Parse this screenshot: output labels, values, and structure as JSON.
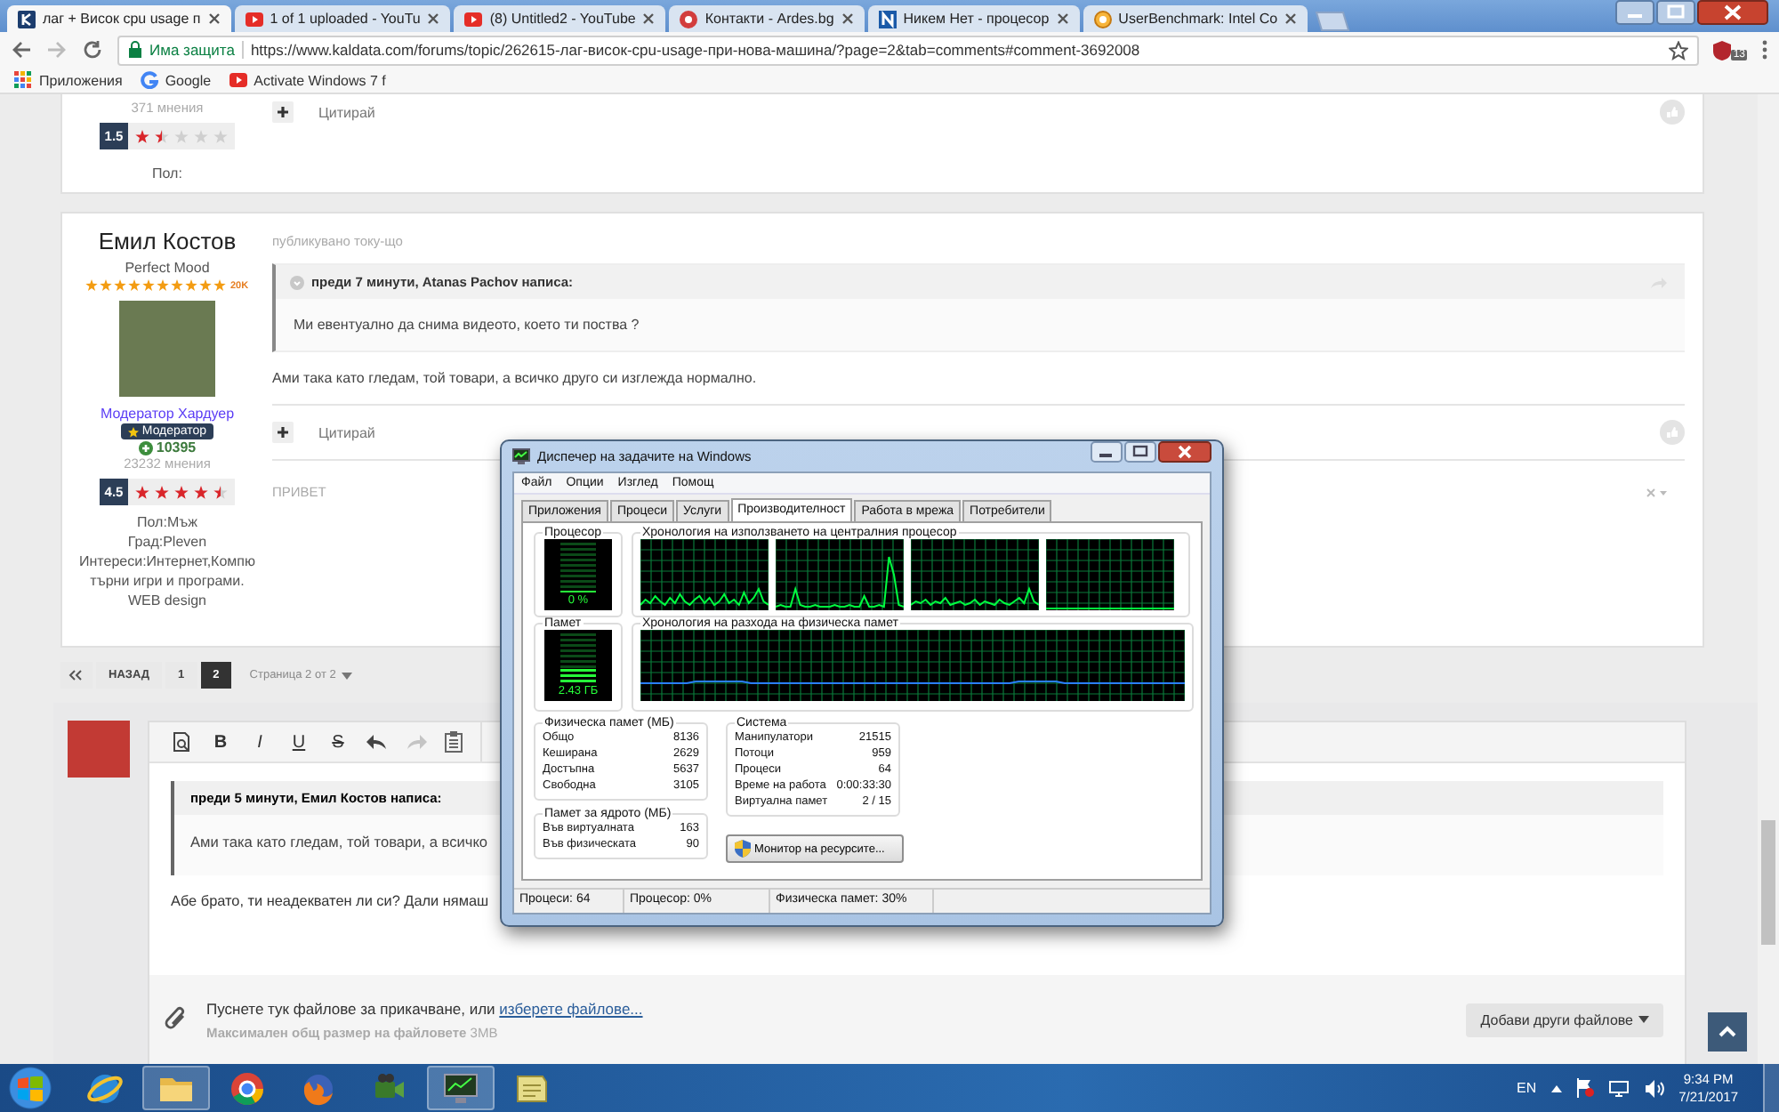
{
  "browser": {
    "tabs": [
      {
        "title": "лаг + Висок cpu usage п",
        "selected": true,
        "kind": "site"
      },
      {
        "title": "1 of 1 uploaded - YouTu",
        "selected": false,
        "kind": "video"
      },
      {
        "title": "(8) Untitled2 - YouTube",
        "selected": false,
        "kind": "video"
      },
      {
        "title": "Контакти - Ardes.bg",
        "selected": false,
        "kind": "shop"
      },
      {
        "title": "Никем Нет - процесор",
        "selected": false,
        "kind": "letter"
      },
      {
        "title": "UserBenchmark: Intel Co",
        "selected": false,
        "kind": "bench"
      }
    ],
    "security": "Има защита",
    "url": "https://www.kaldata.com/forums/topic/262615-лаг-висок-cpu-usage-при-нова-машина/?page=2&tab=comments#comment-3692008",
    "extension_badge": "13",
    "bookmarks": [
      {
        "label": "Приложения",
        "kind": "apps"
      },
      {
        "label": "Google",
        "kind": "google"
      },
      {
        "label": "Activate Windows 7 f",
        "kind": "video"
      }
    ]
  },
  "previous_post": {
    "reviews": "371 мнения",
    "rating": "1.5",
    "stars": 1.5,
    "profile": [
      "Пол:"
    ],
    "quote_action": "Цитирай"
  },
  "post": {
    "author": "Емил Костов",
    "title": "Perfect Mood",
    "rank": {
      "stars": 10,
      "label": "20K"
    },
    "group": "Модератор Хардуер",
    "badge": "Модератор",
    "reputation": "10395",
    "reviews": "23232 мнения",
    "rating": "4.5",
    "stars": 4.5,
    "profile": [
      "Пол:Мъж",
      "Град:Pleven",
      "Интереси:Интернет,Компю търни игри и програми.",
      "WEB design"
    ],
    "posted": "публикувано току-що",
    "quote_header": "преди 7 минути, Atanas Pachov написа:",
    "quote_text": "Ми евентуално да снима видеото, което ти поства ?",
    "body": "Ами така като гледам, той товари, а всичко друго си изглежда нормално.",
    "quote_action": "Цитирай",
    "comment": "ПРИВЕТ"
  },
  "pagination": {
    "back": "НАЗАД",
    "pages": [
      {
        "label": "1",
        "selected": false
      },
      {
        "label": "2",
        "selected": true
      }
    ],
    "summary": "Страница 2 от 2"
  },
  "editor": {
    "format_buttons": [
      "B",
      "I",
      "U",
      "S"
    ],
    "redo_disabled": true,
    "quote_header": "преди 5 минути, Емил Костов написа:",
    "quote_text": "Ами така като гледам, той товари, а всичко",
    "text": "Абе брато, ти неадекватен ли си? Дали нямаш",
    "attach_text": "Пуснете тук файлове за прикачване, или",
    "attach_link": "изберете файлове...",
    "limit_label": "Максимален общ размер на файловете",
    "limit_value": "3MB",
    "add_button": "Добави други файлове"
  },
  "task_manager": {
    "title": "Диспечер на задачите на Windows",
    "menu": [
      "Файл",
      "Опции",
      "Изглед",
      "Помощ"
    ],
    "tabs": [
      {
        "label": "Приложения",
        "selected": false
      },
      {
        "label": "Процеси",
        "selected": false
      },
      {
        "label": "Услуги",
        "selected": false
      },
      {
        "label": "Производителност",
        "selected": true
      },
      {
        "label": "Работа в мрежа",
        "selected": false
      },
      {
        "label": "Потребители",
        "selected": false
      }
    ],
    "cpu": {
      "title": "Процесор",
      "reading": "0 %",
      "level": 0
    },
    "cpu_history": {
      "title": "Хронология на използването на централния процесор"
    },
    "memory": {
      "title": "Памет",
      "reading": "2.43 ГБ",
      "level": 0.3
    },
    "memory_history": {
      "title": "Хронология на разхода на физическа памет"
    },
    "physical_memory": {
      "title": "Физическа памет (МБ)",
      "rows": [
        {
          "label": "Общо",
          "value": "8136"
        },
        {
          "label": "Кеширана",
          "value": "2629"
        },
        {
          "label": "Достъпна",
          "value": "5637"
        },
        {
          "label": "Свободна",
          "value": "3105"
        }
      ]
    },
    "kernel_memory": {
      "title": "Памет за ядрото (МБ)",
      "rows": [
        {
          "label": "Във виртуалната",
          "value": "163"
        },
        {
          "label": "Във физическата",
          "value": "90"
        }
      ]
    },
    "system": {
      "title": "Система",
      "rows": [
        {
          "label": "Манипулатори",
          "value": "21515"
        },
        {
          "label": "Потоци",
          "value": "959"
        },
        {
          "label": "Процеси",
          "value": "64"
        },
        {
          "label": "Време на работа",
          "value": "0:00:33:30"
        },
        {
          "label": "Виртуална памет",
          "value": "2 / 15"
        }
      ]
    },
    "monitor_button": "Монитор на ресурсите...",
    "status": [
      "Процеси: 64",
      "Процесор: 0%",
      "Физическа памет: 30%"
    ]
  },
  "taskbar": {
    "apps": [
      {
        "kind": "ie",
        "open": false
      },
      {
        "kind": "folder",
        "open": true
      },
      {
        "kind": "chrome",
        "open": false
      },
      {
        "kind": "firefox",
        "open": false
      },
      {
        "kind": "camera",
        "open": false
      },
      {
        "kind": "monitor",
        "open": true
      },
      {
        "kind": "note",
        "open": false
      }
    ],
    "language": "EN",
    "time": "9:34 PM",
    "date": "7/21/2017"
  }
}
